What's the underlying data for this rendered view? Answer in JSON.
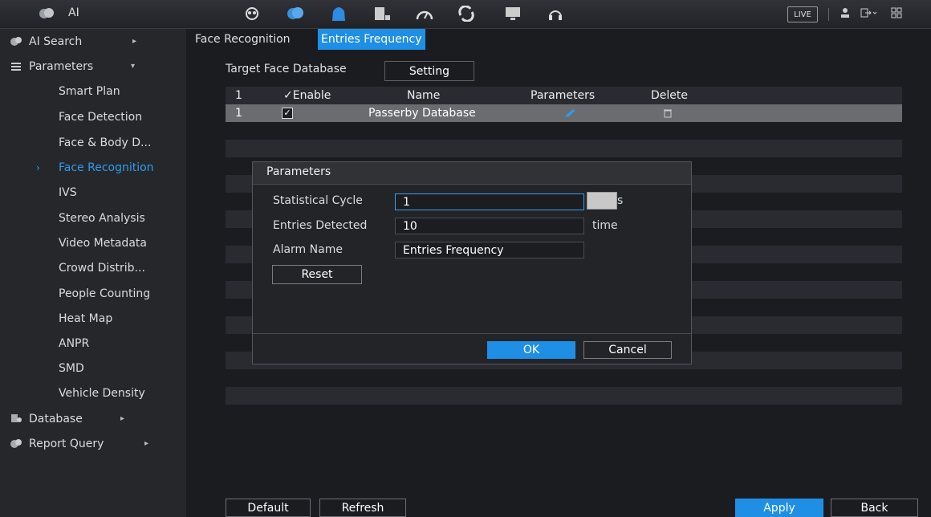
{
  "topbar": {
    "title": "AI",
    "icons": [
      "ai-logo-icon",
      "search-people-icon",
      "ai-brain-icon",
      "alarm-bell-icon",
      "storage-icon",
      "speed-gauge-icon",
      "sync-icon",
      "monitor-icon",
      "headset-icon"
    ],
    "live_label": "LIVE"
  },
  "sidebar": {
    "items": [
      {
        "label": "AI Search"
      },
      {
        "label": "Parameters"
      },
      {
        "label": "Smart Plan"
      },
      {
        "label": "Face Detection"
      },
      {
        "label": "Face & Body D..."
      },
      {
        "label": "Face Recognition"
      },
      {
        "label": "IVS"
      },
      {
        "label": "Stereo Analysis"
      },
      {
        "label": "Video Metadata"
      },
      {
        "label": "Crowd Distrib..."
      },
      {
        "label": "People Counting"
      },
      {
        "label": "Heat Map"
      },
      {
        "label": "ANPR"
      },
      {
        "label": "SMD"
      },
      {
        "label": "Vehicle Density"
      },
      {
        "label": "Database"
      },
      {
        "label": "Report Query"
      }
    ]
  },
  "tabs": [
    {
      "label": "Face Recognition"
    },
    {
      "label": "Entries Frequency"
    }
  ],
  "target": {
    "label": "Target Face Database",
    "setting_button": "Setting"
  },
  "table": {
    "columns": [
      "1",
      "Enable",
      "Name",
      "Parameters",
      "Delete"
    ],
    "rows": [
      {
        "index": "1",
        "enabled": true,
        "name": "Passerby Database"
      }
    ]
  },
  "modal": {
    "title": "Parameters",
    "fields": [
      {
        "label": "Statistical Cycle",
        "value": "1",
        "unit": "s"
      },
      {
        "label": "Entries Detected",
        "value": "10",
        "unit": "time"
      },
      {
        "label": "Alarm Name",
        "value": "Entries Frequency"
      }
    ],
    "reset_button": "Reset",
    "ok_button": "OK",
    "cancel_button": "Cancel"
  },
  "bottom": {
    "default_button": "Default",
    "refresh_button": "Refresh",
    "apply_button": "Apply",
    "back_button": "Back"
  },
  "colors": {
    "accent": "#1f8fe6",
    "background": "#1b1c20",
    "sidebar": "#26272b",
    "selected_row": "#6b6c70"
  }
}
